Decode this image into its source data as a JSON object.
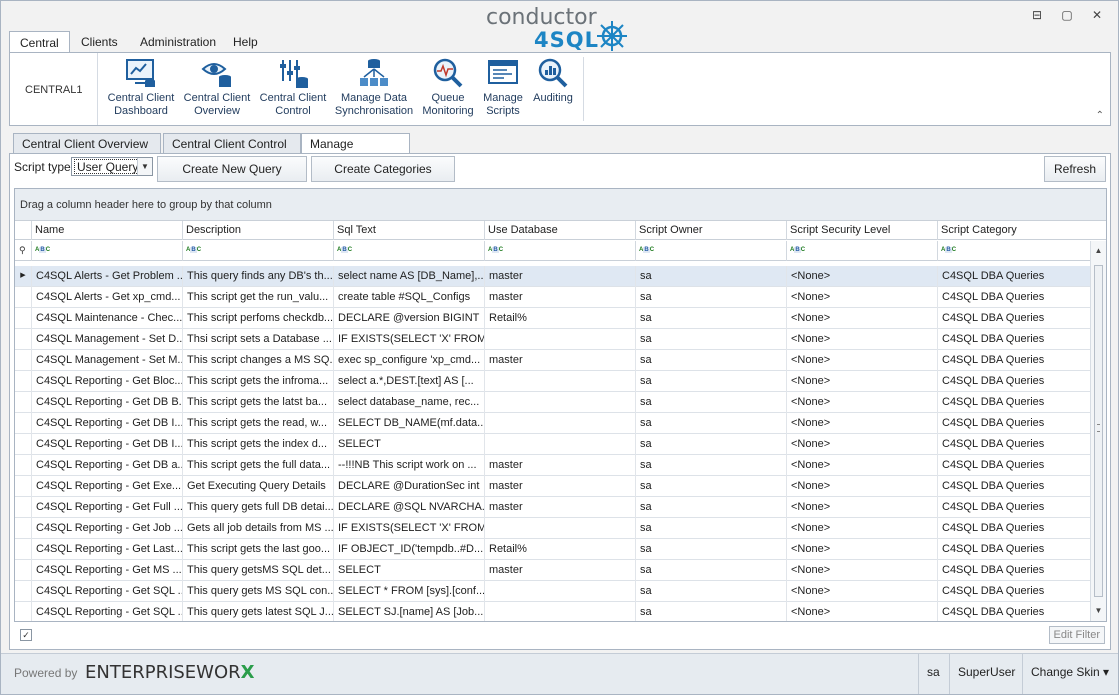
{
  "window": {
    "logo_top": "conductor",
    "logo_bottom": "4SQL",
    "minimize": "⊟",
    "restore": "▢",
    "close": "✕"
  },
  "ribbon": {
    "tabs": [
      "Central",
      "Clients",
      "Administration",
      "Help"
    ],
    "group_label": "CENTRAL1",
    "buttons": [
      {
        "line1": "Central Client",
        "line2": "Dashboard"
      },
      {
        "line1": "Central Client",
        "line2": "Overview"
      },
      {
        "line1": "Central Client",
        "line2": "Control"
      },
      {
        "line1": "Manage Data",
        "line2": "Synchronisation"
      },
      {
        "line1": "Queue",
        "line2": "Monitoring"
      },
      {
        "line1": "Manage",
        "line2": "Scripts"
      },
      {
        "line1": "Auditing",
        "line2": ""
      }
    ],
    "collapse": "⌃"
  },
  "doc_tabs": [
    "Central Client Overview",
    "Central Client Control",
    "Manage Scripts"
  ],
  "toolbar": {
    "script_type_label": "Script type",
    "script_type_value": "User Query",
    "create_query": "Create New Query",
    "create_categories": "Create Categories",
    "refresh": "Refresh"
  },
  "grid": {
    "group_hint": "Drag a column header here to group by that column",
    "columns": [
      "Name",
      "Description",
      "Sql Text",
      "Use Database",
      "Script Owner",
      "Script Security Level",
      "Script Category"
    ],
    "filter_icon_text": "ABC",
    "rows": [
      [
        "C4SQL Alerts - Get Problem ...",
        "This query finds any DB's th...",
        "select name AS [DB_Name],...",
        "master",
        "sa",
        "<None>",
        "C4SQL DBA Queries"
      ],
      [
        "C4SQL Alerts - Get xp_cmd...",
        "This script get the run_valu...",
        "create table #SQL_Configs",
        "master",
        "sa",
        "<None>",
        "C4SQL DBA Queries"
      ],
      [
        "C4SQL Maintenance - Chec...",
        "This script perfoms checkdb...",
        "DECLARE @version BIGINT",
        "Retail%",
        "sa",
        "<None>",
        "C4SQL DBA Queries"
      ],
      [
        "C4SQL Management - Set D...",
        "Thsi script sets a Database ...",
        "IF EXISTS(SELECT 'X' FROM...",
        "",
        "sa",
        "<None>",
        "C4SQL DBA Queries"
      ],
      [
        "C4SQL Management - Set M...",
        "This script changes a MS SQ...",
        "exec sp_configure 'xp_cmd...",
        "master",
        "sa",
        "<None>",
        "C4SQL DBA Queries"
      ],
      [
        "C4SQL Reporting - Get Bloc...",
        "This script gets the infroma...",
        "select a.*,DEST.[text] AS [...",
        "",
        "sa",
        "<None>",
        "C4SQL DBA Queries"
      ],
      [
        "C4SQL Reporting - Get DB B...",
        "This script gets the latst ba...",
        "select database_name, rec...",
        "",
        "sa",
        "<None>",
        "C4SQL DBA Queries"
      ],
      [
        "C4SQL Reporting - Get DB I...",
        "This script gets the read, w...",
        "SELECT DB_NAME(mf.data...",
        "",
        "sa",
        "<None>",
        "C4SQL DBA Queries"
      ],
      [
        "C4SQL Reporting - Get DB I...",
        "This script gets the index d...",
        "SELECT",
        "",
        "sa",
        "<None>",
        "C4SQL DBA Queries"
      ],
      [
        "C4SQL Reporting - Get DB a...",
        "This script gets the full data...",
        "--!!!NB This script work on ...",
        "master",
        "sa",
        "<None>",
        "C4SQL DBA Queries"
      ],
      [
        "C4SQL Reporting - Get Exe...",
        "Get Executing Query Details",
        "DECLARE @DurationSec int",
        "master",
        "sa",
        "<None>",
        "C4SQL DBA Queries"
      ],
      [
        "C4SQL Reporting - Get Full ...",
        "This query gets full DB detai...",
        "DECLARE @SQL NVARCHA...",
        "master",
        "sa",
        "<None>",
        "C4SQL DBA Queries"
      ],
      [
        "C4SQL Reporting - Get Job ...",
        "Gets all job details from MS ...",
        "IF EXISTS(SELECT 'X' FROM...",
        "",
        "sa",
        "<None>",
        "C4SQL DBA Queries"
      ],
      [
        "C4SQL Reporting - Get Last...",
        "This script gets the last goo...",
        "IF OBJECT_ID('tempdb..#D...",
        "Retail%",
        "sa",
        "<None>",
        "C4SQL DBA Queries"
      ],
      [
        "C4SQL Reporting - Get MS ...",
        "This query getsMS SQL det...",
        "SELECT",
        "master",
        "sa",
        "<None>",
        "C4SQL DBA Queries"
      ],
      [
        "C4SQL Reporting - Get SQL ...",
        "This query gets MS SQL con...",
        "SELECT * FROM [sys].[conf...",
        "",
        "sa",
        "<None>",
        "C4SQL DBA Queries"
      ],
      [
        "C4SQL Reporting - Get SQL ...",
        "This query gets latest SQL J...",
        "SELECT SJ.[name] AS [Job...",
        "",
        "sa",
        "<None>",
        "C4SQL DBA Queries"
      ]
    ],
    "filter_checkbox": "✓",
    "edit_filter": "Edit Filter"
  },
  "status": {
    "powered_by": "Powered by",
    "brand_main": "ENTERPRISEWOR",
    "brand_x": "X",
    "user": "sa",
    "role": "SuperUser",
    "skin": "Change Skin ▾"
  }
}
